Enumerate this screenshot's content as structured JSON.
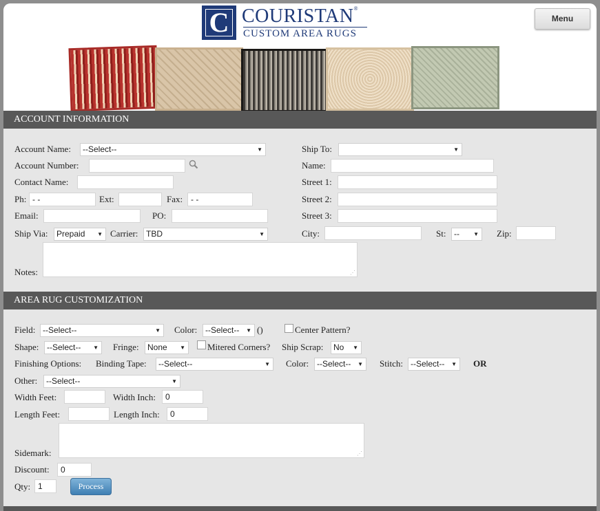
{
  "brand": {
    "name": "COURISTAN",
    "tagline": "CUSTOM AREA RUGS",
    "mark": "C",
    "reg": "®"
  },
  "menu_label": "Menu",
  "account": {
    "section_title": "ACCOUNT INFORMATION",
    "account_name_label": "Account Name:",
    "account_name_value": "--Select--",
    "account_number_label": "Account Number:",
    "contact_name_label": "Contact Name:",
    "ph_label": "Ph:",
    "ph_value": " -  -",
    "ext_label": "Ext:",
    "fax_label": "Fax:",
    "fax_value": " -  -",
    "email_label": "Email:",
    "po_label": "PO:",
    "ship_via_label": "Ship Via:",
    "ship_via_value": "Prepaid",
    "carrier_label": "Carrier:",
    "carrier_value": "TBD",
    "notes_label": "Notes:",
    "ship_to_label": "Ship To:",
    "name_label": "Name:",
    "street1_label": "Street 1:",
    "street2_label": "Street 2:",
    "street3_label": "Street 3:",
    "city_label": "City:",
    "st_label": "St:",
    "st_value": "--",
    "zip_label": "Zip:"
  },
  "customization": {
    "section_title": "AREA RUG CUSTOMIZATION",
    "field_label": "Field:",
    "field_value": "--Select--",
    "color_label": "Color:",
    "color_value": "--Select--",
    "color_suffix": "()",
    "center_pattern_label": "Center Pattern?",
    "shape_label": "Shape:",
    "shape_value": "--Select--",
    "fringe_label": "Fringe:",
    "fringe_value": "None",
    "mitered_label": "Mitered Corners?",
    "ship_scrap_label": "Ship Scrap:",
    "ship_scrap_value": "No",
    "finishing_label": "Finishing Options:",
    "binding_label": "Binding Tape:",
    "binding_value": "--Select--",
    "color2_label": "Color:",
    "color2_value": "--Select--",
    "stitch_label": "Stitch:",
    "stitch_value": "--Select--",
    "or_label": "OR",
    "other_label": "Other:",
    "other_value": "--Select--",
    "width_feet_label": "Width Feet:",
    "width_inch_label": "Width Inch:",
    "width_inch_value": "0",
    "length_feet_label": "Length Feet:",
    "length_inch_label": "Length Inch:",
    "length_inch_value": "0",
    "sidemark_label": "Sidemark:",
    "discount_label": "Discount:",
    "discount_value": "0",
    "qty_label": "Qty:",
    "qty_value": "1",
    "process_label": "Process"
  },
  "arrow_glyph": "▼",
  "grip_glyph": "⋰"
}
